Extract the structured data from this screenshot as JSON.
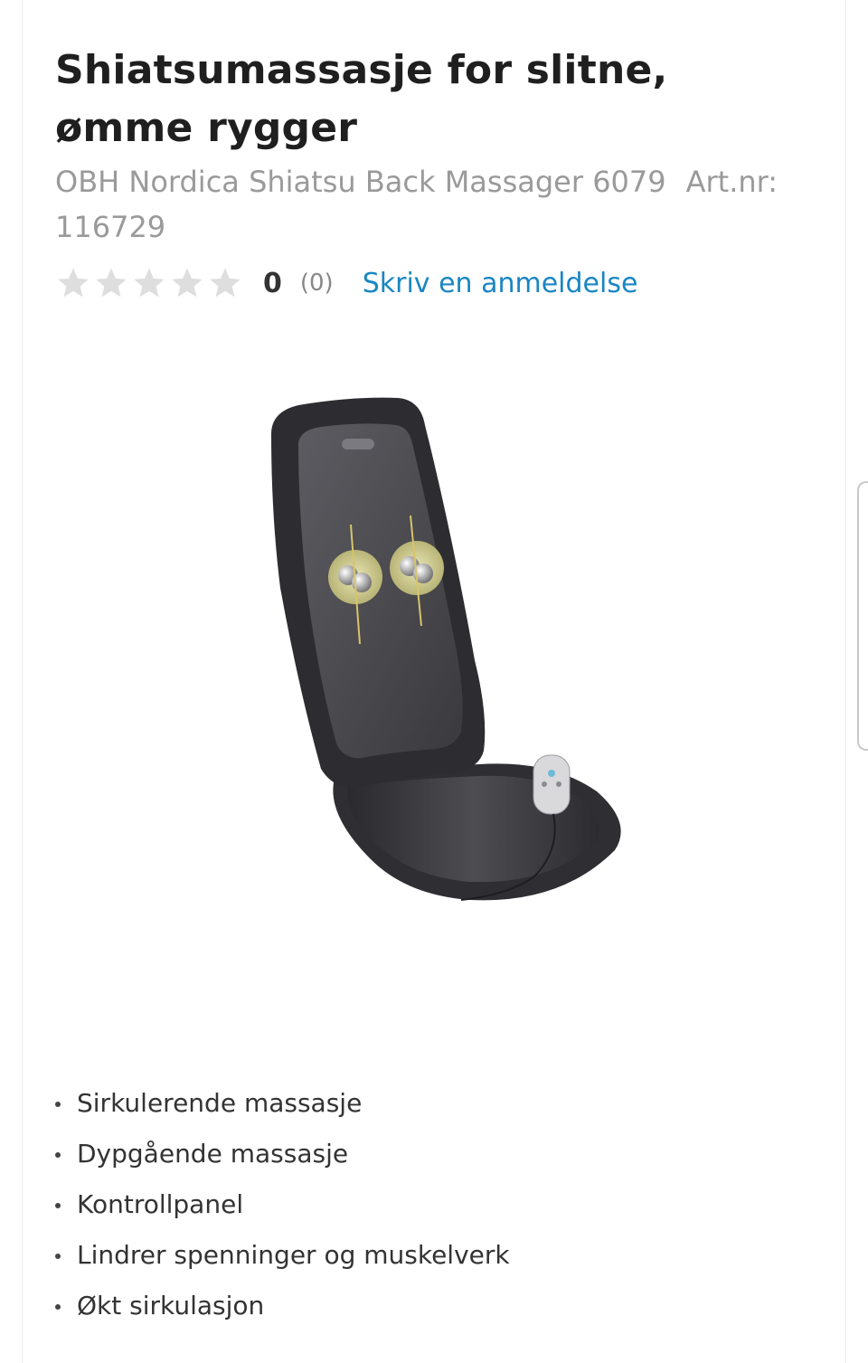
{
  "product": {
    "title": "Shiatsumassasje for slitne, ømme rygger",
    "name": "OBH Nordica Shiatsu Back Massager 6079",
    "article_number": "Art.nr: 116729"
  },
  "rating": {
    "stars_filled": 0,
    "stars_total": 5,
    "score": "0",
    "count": "(0)",
    "review_link": "Skriv en anmeldelse"
  },
  "image": {
    "alt": "OBH Nordica Shiatsu Back Massager 6079"
  },
  "features": [
    "Sirkulerende massasje",
    "Dypgående massasje",
    "Kontrollpanel",
    "Lindrer spenninger og muskelverk",
    "Økt sirkulasjon"
  ],
  "colors": {
    "title": "#1f1f1f",
    "muted": "#9a9a9a",
    "link": "#1a86c2",
    "star_empty": "#dedede"
  }
}
